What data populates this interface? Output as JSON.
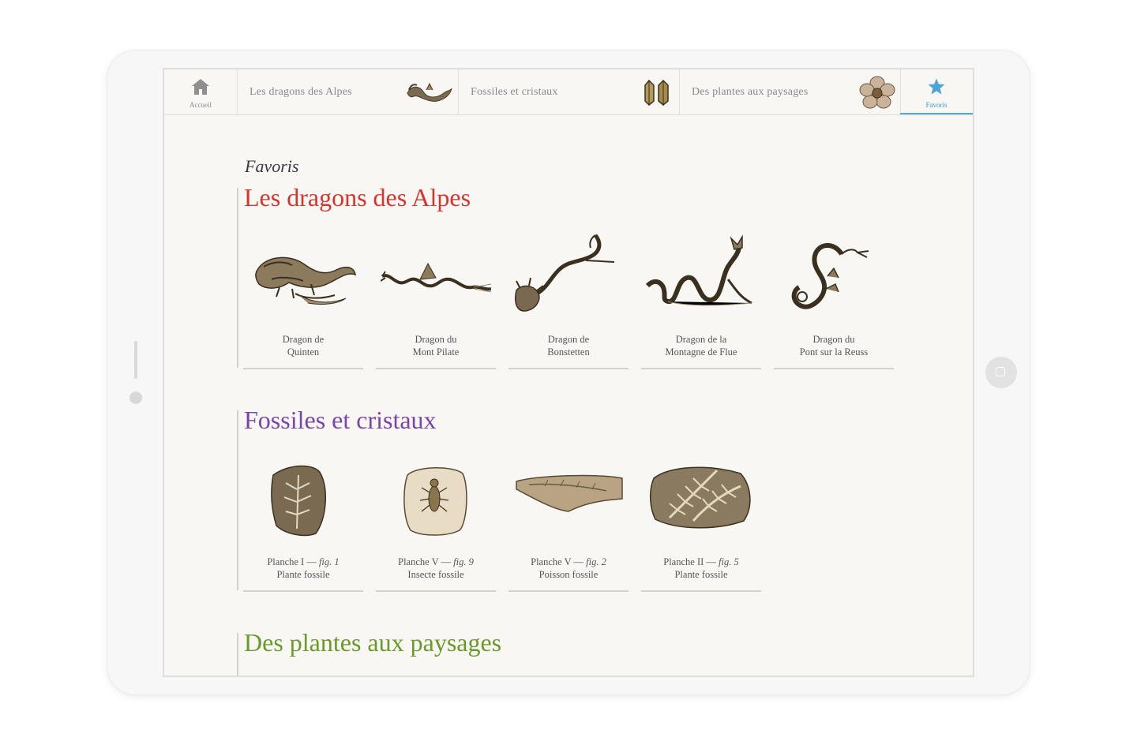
{
  "nav": {
    "home_label": "Accueil",
    "items": [
      {
        "label": "Les dragons des Alpes",
        "thumb": "dragon-thumb"
      },
      {
        "label": "Fossiles et cristaux",
        "thumb": "crystal-thumb"
      },
      {
        "label": "Des plantes aux paysages",
        "thumb": "flower-thumb"
      }
    ],
    "favorites_label": "Favoris",
    "active_color": "#3c9ccc"
  },
  "page_title": "Favoris",
  "sections": [
    {
      "title": "Les dragons des Alpes",
      "color": "#d9342b",
      "cards": [
        {
          "line1": "Dragon de",
          "line2": "Quinten",
          "icon": "dragon-quinten"
        },
        {
          "line1": "Dragon du",
          "line2": "Mont Pilate",
          "icon": "dragon-pilate"
        },
        {
          "line1": "Dragon de",
          "line2": "Bonstetten",
          "icon": "dragon-bonstetten"
        },
        {
          "line1": "Dragon de la",
          "line2": "Montagne de Flue",
          "icon": "dragon-flue"
        },
        {
          "line1": "Dragon du",
          "line2": "Pont sur la Reuss",
          "icon": "dragon-reuss"
        }
      ]
    },
    {
      "title": "Fossiles et cristaux",
      "color": "#7a45a8",
      "cards": [
        {
          "plate": "Planche I — ",
          "fig": "fig. 1",
          "line2": "Plante fossile",
          "icon": "fossil-plant"
        },
        {
          "plate": "Planche V — ",
          "fig": "fig. 9",
          "line2": "Insecte fossile",
          "icon": "fossil-insect"
        },
        {
          "plate": "Planche V — ",
          "fig": "fig. 2",
          "line2": "Poisson fossile",
          "icon": "fossil-fish"
        },
        {
          "plate": "Planche II — ",
          "fig": "fig. 5",
          "line2": "Plante fossile",
          "icon": "fossil-fern"
        }
      ]
    },
    {
      "title": "Des plantes aux paysages",
      "color": "#6a9a2a",
      "cards": []
    }
  ]
}
